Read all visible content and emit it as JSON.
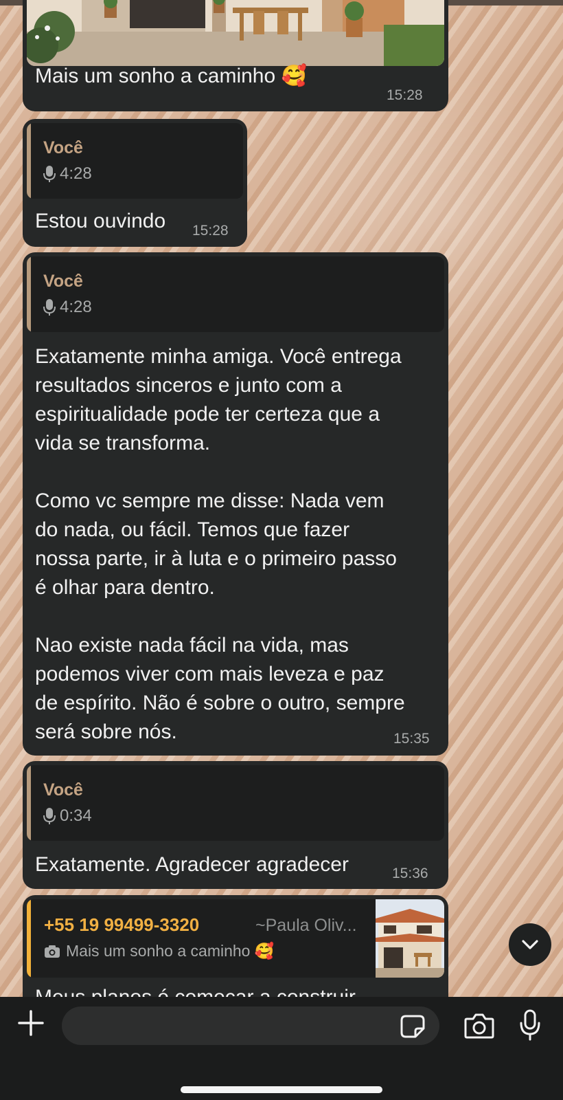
{
  "messages": [
    {
      "type": "photo",
      "caption": "Mais um sonho a caminho 🥰",
      "time": "15:28"
    },
    {
      "type": "quoted",
      "quote_author": "Você",
      "quote_duration": "4:28",
      "text": "Estou ouvindo",
      "time": "15:28"
    },
    {
      "type": "quoted",
      "quote_author": "Você",
      "quote_duration": "4:28",
      "text": "Exatamente minha amiga. Você entrega\nresultados sinceros e junto com a\nespiritualidade pode ter certeza que a\nvida se transforma.\n\nComo vc sempre me disse: Nada vem\ndo nada, ou fácil. Temos que fazer\nnossa parte, ir à luta e o primeiro passo\né olhar para dentro.\n\nNao existe nada fácil na vida, mas\npodemos viver com mais leveza e paz\nde espírito. Não é sobre o outro, sempre\nserá sobre nós.",
      "time": "15:35"
    },
    {
      "type": "quoted",
      "quote_author": "Você",
      "quote_duration": "0:34",
      "text": "Exatamente. Agradecer agradecer",
      "time": "15:36"
    },
    {
      "type": "reply",
      "reply_phone": "+55 19 99499-3320",
      "reply_author": "~Paula Oliv...",
      "reply_caption": "Mais um sonho a caminho 🥰",
      "text": "Meus planos é começar a construir"
    }
  ],
  "icons": {
    "mic_small": "microphone-icon",
    "camera_small": "camera-icon",
    "scroll": "chevron-down-icon",
    "plus": "plus-icon",
    "sticker": "sticker-icon",
    "camera": "camera-icon",
    "mic": "microphone-icon"
  },
  "colors": {
    "bubble": "#262828",
    "quote_accent": "#b79b7d",
    "reply_accent": "#f4b23a"
  }
}
